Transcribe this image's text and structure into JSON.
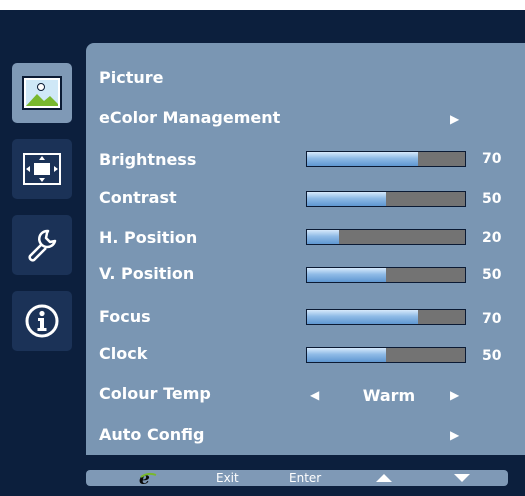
{
  "sidebar": {
    "tabs": [
      {
        "name": "picture-tab",
        "icon": "picture-icon",
        "active": true
      },
      {
        "name": "display-position-tab",
        "icon": "position-icon",
        "active": false
      },
      {
        "name": "settings-tab",
        "icon": "wrench-icon",
        "active": false
      },
      {
        "name": "information-tab",
        "icon": "info-icon",
        "active": false
      }
    ]
  },
  "menu": {
    "title": "Picture",
    "ecolor": "eColor Management",
    "brightness": {
      "label": "Brightness",
      "value": "70",
      "level": 70
    },
    "contrast": {
      "label": "Contrast",
      "value": "50",
      "level": 50
    },
    "h_position": {
      "label": "H. Position",
      "value": "20",
      "level": 20
    },
    "v_position": {
      "label": "V. Position",
      "value": "50",
      "level": 50
    },
    "focus": {
      "label": "Focus",
      "value": "70",
      "level": 70
    },
    "clock": {
      "label": "Clock",
      "value": "50",
      "level": 50
    },
    "colour_temp": {
      "label": "Colour Temp",
      "value": "Warm"
    },
    "auto_config": "Auto Config"
  },
  "footer": {
    "exit": "Exit",
    "enter": "Enter"
  },
  "colors": {
    "background": "#0c1f3d",
    "panel": "#7a96b3",
    "bar_track": "#737373",
    "bar_fill": "#8fbbe6"
  }
}
